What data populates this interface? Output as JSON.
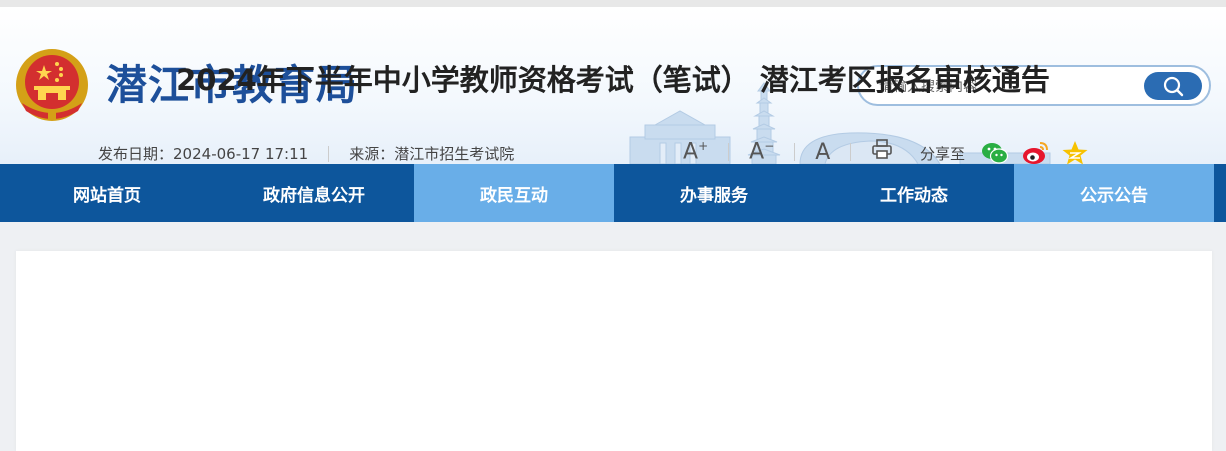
{
  "site": {
    "title": "潜江市教育局"
  },
  "search": {
    "placeholder": "请输入搜索内容"
  },
  "nav": {
    "items": [
      {
        "label": "网站首页",
        "active": false
      },
      {
        "label": "政府信息公开",
        "active": false
      },
      {
        "label": "政民互动",
        "active": true
      },
      {
        "label": "办事服务",
        "active": false
      },
      {
        "label": "工作动态",
        "active": false
      },
      {
        "label": "公示公告",
        "active": true
      }
    ]
  },
  "article": {
    "title": "2024年下半年中小学教师资格考试（笔试） 潜江考区报名审核通告",
    "date_label": "发布日期：",
    "date": "2024-06-17 17:11",
    "source_label": "来源：",
    "source": "潜江市招生考试院"
  },
  "tools": {
    "font_large": "A",
    "font_large_mark": "+",
    "font_small": "A",
    "font_small_mark": "−",
    "font_default": "A"
  },
  "share": {
    "label": "分享至",
    "icons": [
      "wechat-icon",
      "weibo-icon",
      "qzone-icon"
    ]
  },
  "colors": {
    "brand": "#1d4f9a",
    "nav": "#0d569c",
    "nav_active": "#69aee8",
    "search_button": "#2b6cb3"
  }
}
